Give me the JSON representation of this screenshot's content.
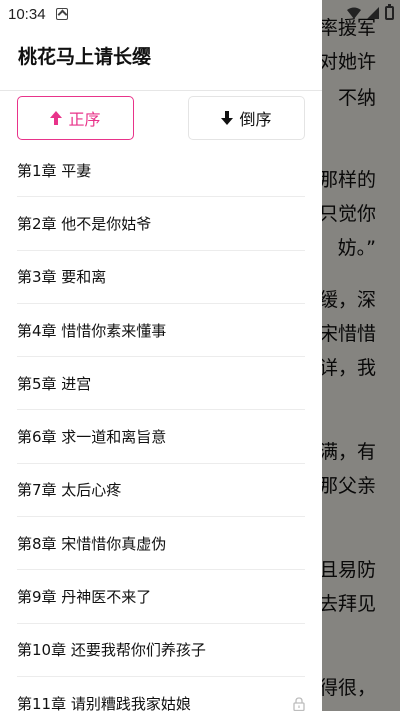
{
  "status_bar": {
    "time": "10:34"
  },
  "book": {
    "title": "桃花马上请长缨"
  },
  "sort": {
    "ascending_label": "正序",
    "descending_label": "倒序"
  },
  "chapters": [
    {
      "label": "第1章 平妻"
    },
    {
      "label": "第2章 他不是你姑爷"
    },
    {
      "label": "第3章 要和离"
    },
    {
      "label": "第4章 惜惜你素来懂事"
    },
    {
      "label": "第5章 进宫"
    },
    {
      "label": "第6章 求一道和离旨意"
    },
    {
      "label": "第7章 太后心疼"
    },
    {
      "label": "第8章 宋惜惜你真虚伪"
    },
    {
      "label": "第9章 丹神医不来了"
    },
    {
      "label": "第10章 还要我帮你们养孩子"
    },
    {
      "label": "第11章 请别糟践我家姑娘",
      "locked": true
    }
  ],
  "reader_background": {
    "lines": [
      "率援军",
      "对她许",
      "不纳",
      "那样的",
      "只觉你",
      "妨。”",
      "缓，深",
      "宋惜惜",
      "详，我",
      "满，有",
      "那父亲",
      "且易防",
      "去拜见",
      "得很，"
    ]
  },
  "colors": {
    "accent": "#e8338a",
    "text": "#111111",
    "divider": "#ececec"
  },
  "icons": [
    "arrow-up-icon",
    "arrow-down-icon",
    "lock-icon",
    "wifi-icon",
    "signal-icon",
    "battery-icon",
    "notification-a-icon"
  ]
}
